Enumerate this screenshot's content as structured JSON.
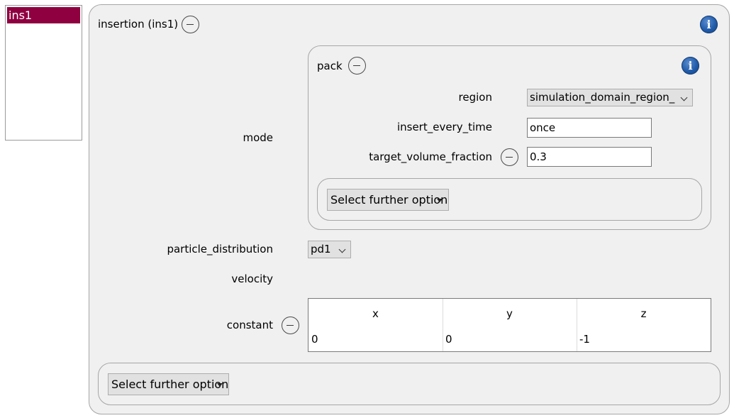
{
  "list": {
    "items": [
      {
        "label": "ins1",
        "selected": true
      }
    ],
    "selected_color": "#8e0040"
  },
  "insertion": {
    "title": "insertion (ins1)",
    "mode_label": "mode",
    "pack": {
      "title": "pack",
      "region_label": "region",
      "region_value": "simulation_domain_region_",
      "insert_every_time_label": "insert_every_time",
      "insert_every_time_value": "once",
      "target_volume_fraction_label": "target_volume_fraction",
      "target_volume_fraction_value": "0.3",
      "further_option_label": "Select further option"
    },
    "particle_distribution_label": "particle_distribution",
    "particle_distribution_value": "pd1",
    "velocity_label": "velocity",
    "constant_label": "constant",
    "constant_headers": [
      "x",
      "y",
      "z"
    ],
    "constant_values": [
      "0",
      "0",
      "-1"
    ],
    "further_option_label": "Select further option"
  },
  "icons": {
    "info": "info-icon",
    "remove": "minus-circle-icon",
    "dropdown": "chevron-down-icon"
  }
}
